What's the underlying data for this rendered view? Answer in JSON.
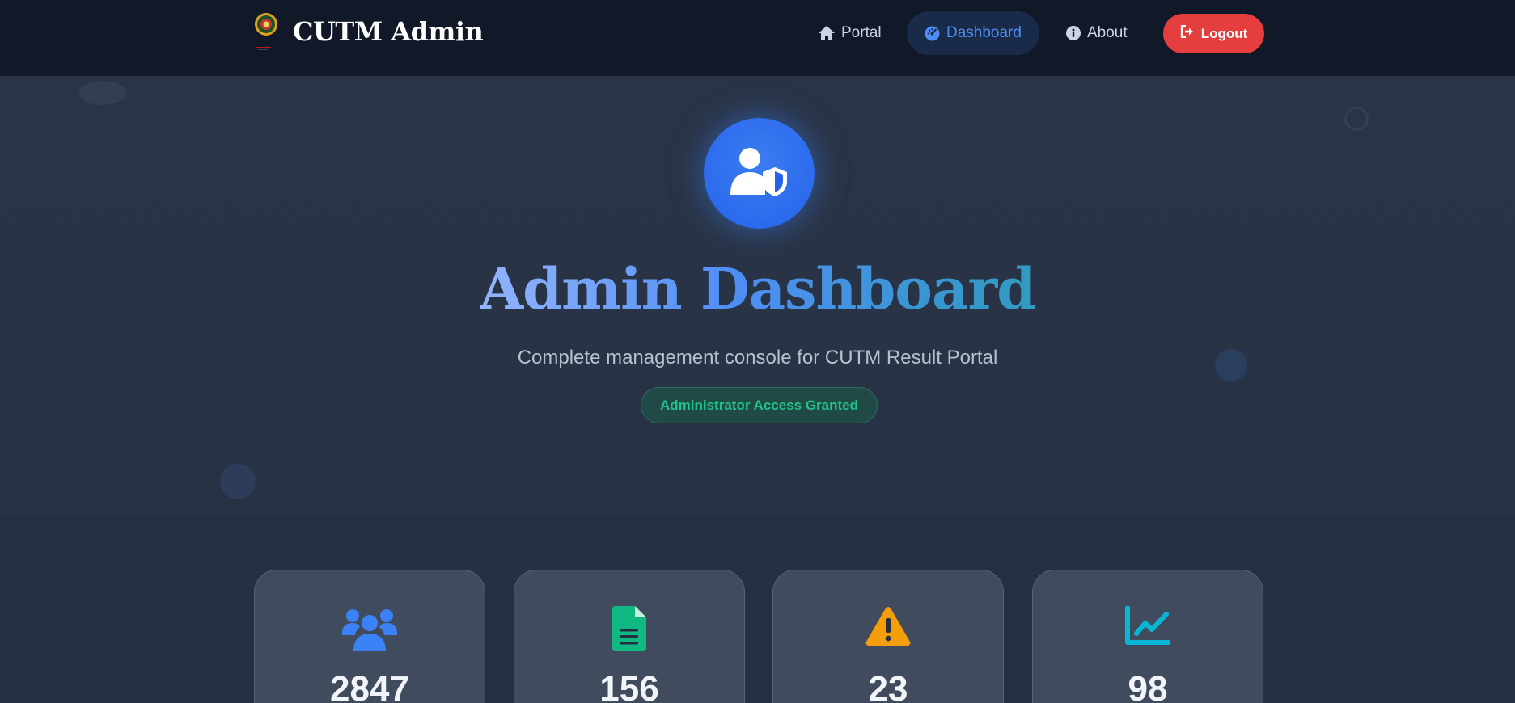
{
  "navbar": {
    "brand_name": "CUTM Admin",
    "logo_icon": "university-seal-icon",
    "links": [
      {
        "label": "Portal",
        "icon": "home-icon"
      },
      {
        "label": "Dashboard",
        "icon": "gauge-icon",
        "active": true
      },
      {
        "label": "About",
        "icon": "info-icon"
      }
    ],
    "logout_label": "Logout",
    "logout_icon": "logout-icon"
  },
  "hero": {
    "avatar_icon": "user-shield-icon",
    "title": "Admin Dashboard",
    "subtitle": "Complete management console for CUTM Result Portal",
    "badge": "Administrator Access Granted"
  },
  "stats": [
    {
      "icon": "users-icon",
      "value": "2847",
      "color": "#3b82f6"
    },
    {
      "icon": "document-icon",
      "value": "156",
      "color": "#10b981"
    },
    {
      "icon": "warning-icon",
      "value": "23",
      "color": "#f59e0b"
    },
    {
      "icon": "chart-line-icon",
      "value": "98",
      "color": "#06b6d4"
    }
  ],
  "colors": {
    "navbar_bg": "#111827",
    "accent": "#3b82f6",
    "logout": "#e53e3e",
    "badge_text": "#22c18a"
  }
}
